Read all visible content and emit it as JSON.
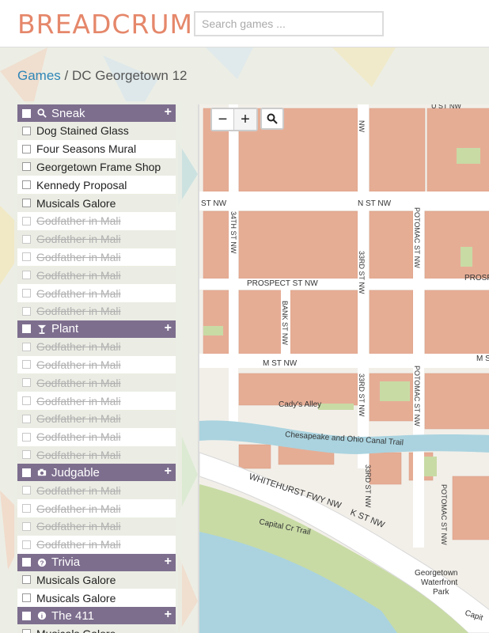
{
  "header": {
    "logo": "BREADCRUMB",
    "search_placeholder": "Search games ..."
  },
  "breadcrumb": {
    "link": "Games",
    "separator": " / ",
    "current": "DC Georgetown 12"
  },
  "sidebar": {
    "groups": [
      {
        "title": "Sneak",
        "icon": "search-icon",
        "items": [
          {
            "label": "Dog Stained Glass",
            "done": false
          },
          {
            "label": "Four Seasons Mural",
            "done": false
          },
          {
            "label": "Georgetown Frame Shop",
            "done": false
          },
          {
            "label": "Kennedy Proposal",
            "done": false
          },
          {
            "label": "Musicals Galore",
            "done": false
          },
          {
            "label": "Godfather in Mali",
            "done": true
          },
          {
            "label": "Godfather in Mali",
            "done": true
          },
          {
            "label": "Godfather in Mali",
            "done": true
          },
          {
            "label": "Godfather in Mali",
            "done": true
          },
          {
            "label": "Godfather in Mali",
            "done": true
          },
          {
            "label": "Godfather in Mali",
            "done": true
          }
        ]
      },
      {
        "title": "Plant",
        "icon": "cocktail-glass-icon",
        "items": [
          {
            "label": "Godfather in Mali",
            "done": true
          },
          {
            "label": "Godfather in Mali",
            "done": true
          },
          {
            "label": "Godfather in Mali",
            "done": true
          },
          {
            "label": "Godfather in Mali",
            "done": true
          },
          {
            "label": "Godfather in Mali",
            "done": true
          },
          {
            "label": "Godfather in Mali",
            "done": true
          },
          {
            "label": "Godfather in Mali",
            "done": true
          }
        ]
      },
      {
        "title": "Judgable",
        "icon": "camera-icon",
        "items": [
          {
            "label": "Godfather in Mali",
            "done": true
          },
          {
            "label": "Godfather in Mali",
            "done": true
          },
          {
            "label": "Godfather in Mali",
            "done": true
          },
          {
            "label": "Godfather in Mali",
            "done": true
          }
        ]
      },
      {
        "title": "Trivia",
        "icon": "question-circle-icon",
        "items": [
          {
            "label": "Musicals Galore",
            "done": false
          },
          {
            "label": "Musicals Galore",
            "done": false
          }
        ]
      },
      {
        "title": "The 411",
        "icon": "info-circle-icon",
        "items": [
          {
            "label": "Musicals Galore",
            "done": false
          }
        ]
      }
    ],
    "add_symbol": "+"
  },
  "map": {
    "zoom_out": "−",
    "zoom_in": "+",
    "labels": {
      "n_st": "N ST NW",
      "n_st_left": "ST NW",
      "o_st": "O ST NW",
      "prospect": "PROSPECT ST NW",
      "prospect_right": "PROSPE",
      "m_st": "M ST NW",
      "m_st_right": "M S",
      "m_st_left": "ST NW",
      "st34": "34TH ST NW",
      "bank": "BANK ST NW",
      "st33": "33RD ST NW",
      "potomac": "POTOMAC ST NW",
      "nw_top": "NW",
      "cadys": "Cady's Alley",
      "canal": "Chesapeake and Ohio Canal Trail",
      "whitehurst": "WHITEHURST FWY NW",
      "k_st": "K ST NW",
      "capital_trail": "Capital Cr Trail",
      "capital_right": "Capit",
      "waterfront": "Georgetown Waterfront Park"
    }
  },
  "colors": {
    "accent": "#e5876a",
    "group_header": "#7d6e8e",
    "link": "#2e86b7",
    "building": "#e6ad95",
    "road": "#ffffff",
    "water": "#aad3df",
    "park": "#c8dba5"
  }
}
